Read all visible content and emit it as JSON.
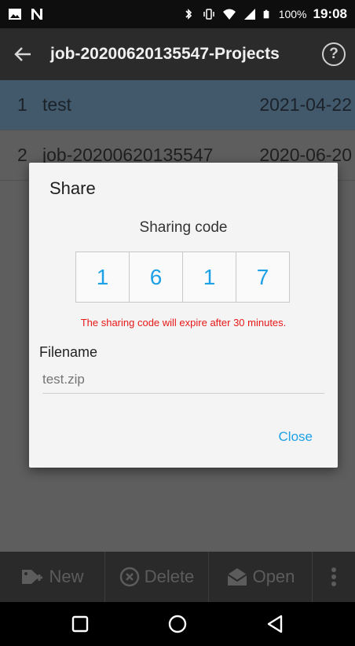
{
  "status_bar": {
    "battery_percent": "100%",
    "time": "19:08"
  },
  "toolbar": {
    "title": "job-20200620135547-Projects",
    "help_label": "?"
  },
  "list": {
    "rows": [
      {
        "index": "1",
        "name": "test",
        "date": "2021-04-22",
        "selected": true
      },
      {
        "index": "2",
        "name": "job-20200620135547",
        "date": "2020-06-20",
        "selected": false
      }
    ]
  },
  "dialog": {
    "title": "Share",
    "code_label": "Sharing code",
    "code_digits": [
      "1",
      "6",
      "1",
      "7"
    ],
    "expire_message": "The sharing code will expire after 30 minutes.",
    "filename_label": "Filename",
    "filename_placeholder": "test.zip",
    "close_label": "Close"
  },
  "actions": {
    "new_label": "New",
    "delete_label": "Delete",
    "open_label": "Open"
  },
  "colors": {
    "accent": "#1ea0e6",
    "error": "#e81818",
    "selected_row": "#42596c",
    "toolbar": "#2b2b2b"
  }
}
